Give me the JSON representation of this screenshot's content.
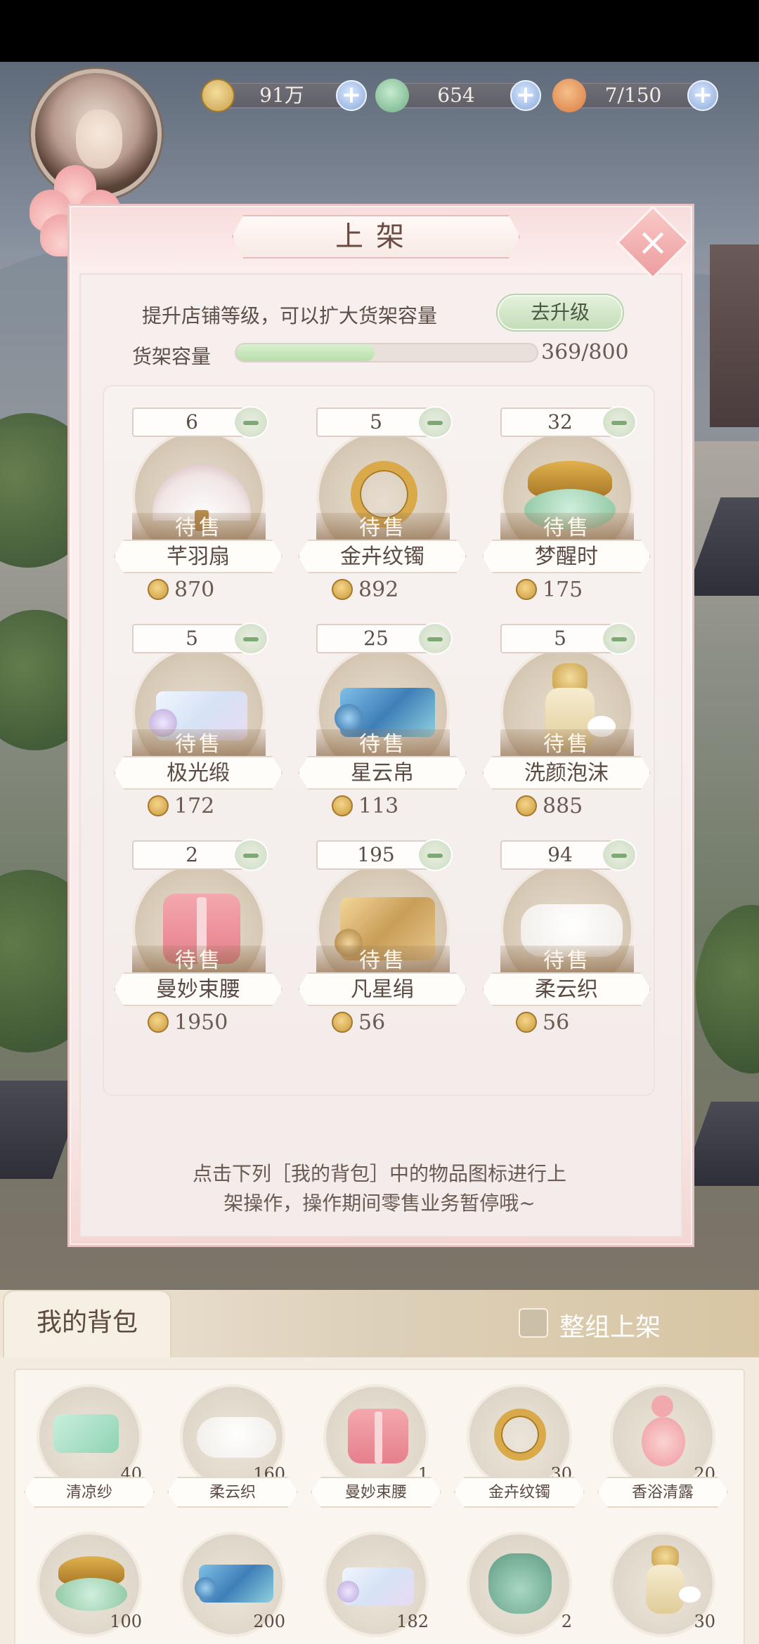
{
  "resources": [
    {
      "name": "paw-coin",
      "value": "91万",
      "color": "#d6b565"
    },
    {
      "name": "jade-bird",
      "value": "654",
      "color": "#8fc6a0"
    },
    {
      "name": "bun",
      "value": "7/150",
      "color": "#e49a5e"
    }
  ],
  "dialog": {
    "title": "上架",
    "hint": "提升店铺等级，可以扩大货架容量",
    "upgrade_label": "去升级",
    "capacity_label": "货架容量",
    "capacity_value": "369/800",
    "capacity_fraction": 0.46,
    "sale_label": "待售",
    "note_line1": "点击下列［我的背包］中的物品图标进行上",
    "note_line2": "架操作，操作期间零售业务暂停哦~"
  },
  "shelf_items": [
    {
      "qty": "6",
      "name": "芊羽扇",
      "price": "870",
      "icon": "fan-icon"
    },
    {
      "qty": "5",
      "name": "金卉纹镯",
      "price": "892",
      "icon": "bracelet-icon"
    },
    {
      "qty": "32",
      "name": "梦醒时",
      "price": "175",
      "icon": "powder-bowl-icon"
    },
    {
      "qty": "5",
      "name": "极光缎",
      "price": "172",
      "icon": "silk-roll-icon"
    },
    {
      "qty": "25",
      "name": "星云帛",
      "price": "113",
      "icon": "blue-roll-icon"
    },
    {
      "qty": "5",
      "name": "洗颜泡沫",
      "price": "885",
      "icon": "bottle-icon"
    },
    {
      "qty": "2",
      "name": "曼妙束腰",
      "price": "1950",
      "icon": "corset-icon"
    },
    {
      "qty": "195",
      "name": "凡星绢",
      "price": "56",
      "icon": "gold-roll-icon"
    },
    {
      "qty": "94",
      "name": "柔云织",
      "price": "56",
      "icon": "white-cloth-icon"
    }
  ],
  "bag": {
    "tab_label": "我的背包",
    "group_label": "整组上架",
    "items": [
      {
        "name": "清凉纱",
        "count": "40",
        "icon": "green-cloth-icon"
      },
      {
        "name": "柔云织",
        "count": "160",
        "icon": "white-cloth-icon"
      },
      {
        "name": "曼妙束腰",
        "count": "1",
        "icon": "corset-icon"
      },
      {
        "name": "金卉纹镯",
        "count": "30",
        "icon": "bracelet-icon"
      },
      {
        "name": "香浴清露",
        "count": "20",
        "icon": "pink-gourd-icon"
      },
      {
        "name": "",
        "count": "100",
        "icon": "powder-bowl-icon"
      },
      {
        "name": "",
        "count": "200",
        "icon": "blue-roll-icon"
      },
      {
        "name": "",
        "count": "182",
        "icon": "silk-roll-icon"
      },
      {
        "name": "",
        "count": "2",
        "icon": "pouch-icon"
      },
      {
        "name": "",
        "count": "30",
        "icon": "bottle-icon"
      }
    ]
  }
}
